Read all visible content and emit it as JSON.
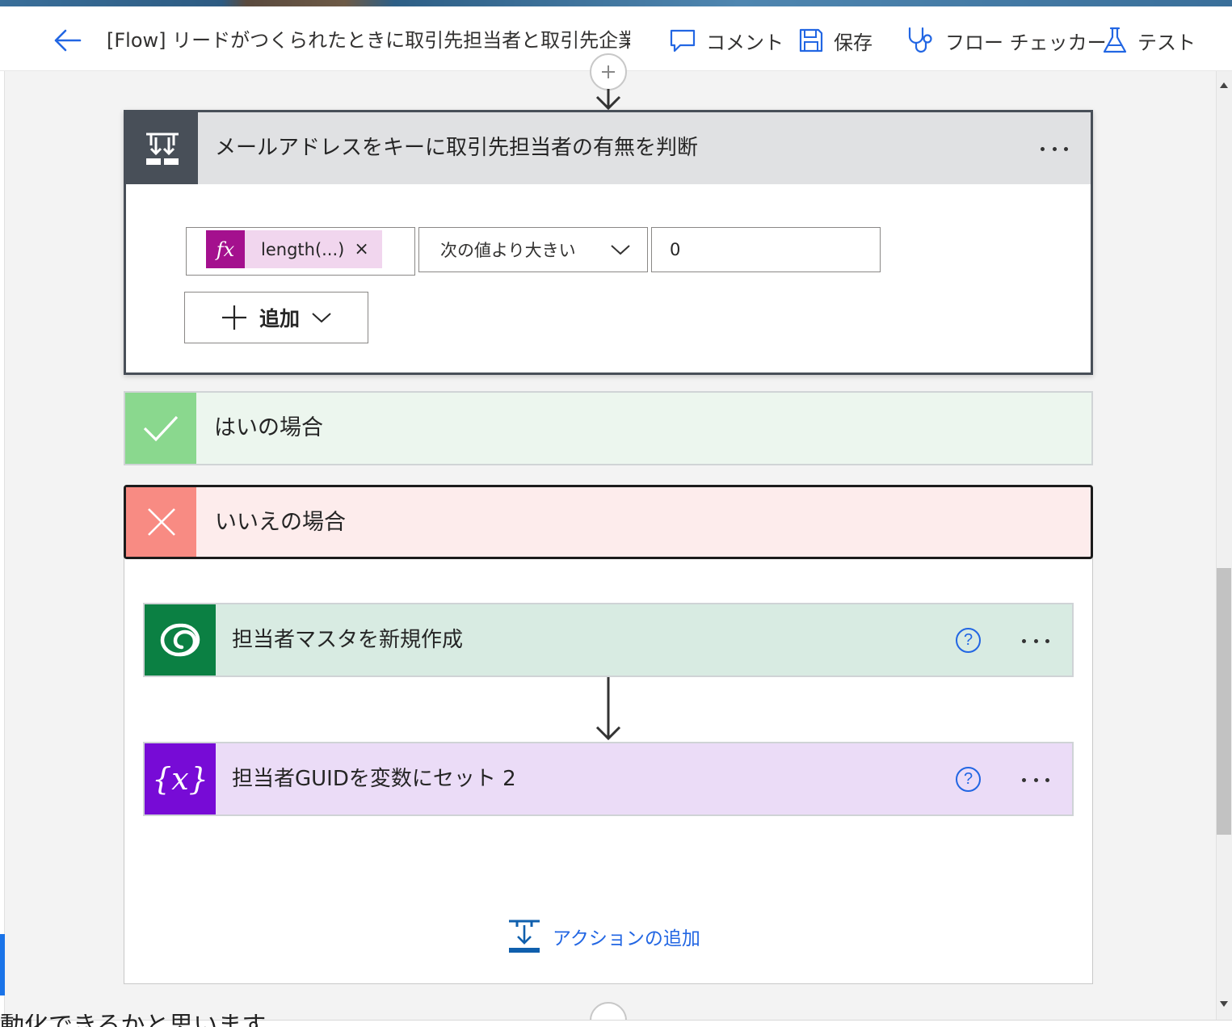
{
  "header": {
    "flow_title": "[Flow] リードがつくられたときに取引先担当者と取引先企業",
    "commands": {
      "comment": "コメント",
      "save": "保存",
      "flow_checker": "フロー チェッカー",
      "test": "テスト"
    }
  },
  "condition": {
    "title": "メールアドレスをキーに取引先担当者の有無を判断",
    "expression_token": "length(...)",
    "token_remove": "×",
    "fx_label": "fx",
    "operator": "次の値より大きい",
    "value": "0",
    "add_label": "追加"
  },
  "yes_branch": {
    "title": "はいの場合"
  },
  "no_branch": {
    "title": "いいえの場合",
    "actions": [
      {
        "title": "担当者マスタを新規作成",
        "help": "?"
      },
      {
        "title": "担当者GUIDを変数にセット 2",
        "help": "?",
        "icon_text": "{x}"
      }
    ],
    "add_action_label": "アクションの追加"
  },
  "footer_text": "動化できるかと思います",
  "icons": {
    "back": "arrow-left-icon",
    "comment": "speech-bubble-icon",
    "save": "floppy-disk-icon",
    "flow_checker": "stethoscope-icon",
    "test": "flask-icon",
    "condition": "condition-icon",
    "yes": "checkmark-icon",
    "no": "cross-icon",
    "dataverse": "dataverse-icon",
    "variable": "variable-icon",
    "add_action": "add-action-icon"
  },
  "colors": {
    "accent_blue": "#2266e3",
    "condition_dark": "#484f58",
    "yes_green": "#8ad88e",
    "no_red": "#f88b83",
    "dataverse_green": "#0b8043",
    "variable_purple": "#770bd6",
    "expression_magenta": "#a4108e"
  }
}
